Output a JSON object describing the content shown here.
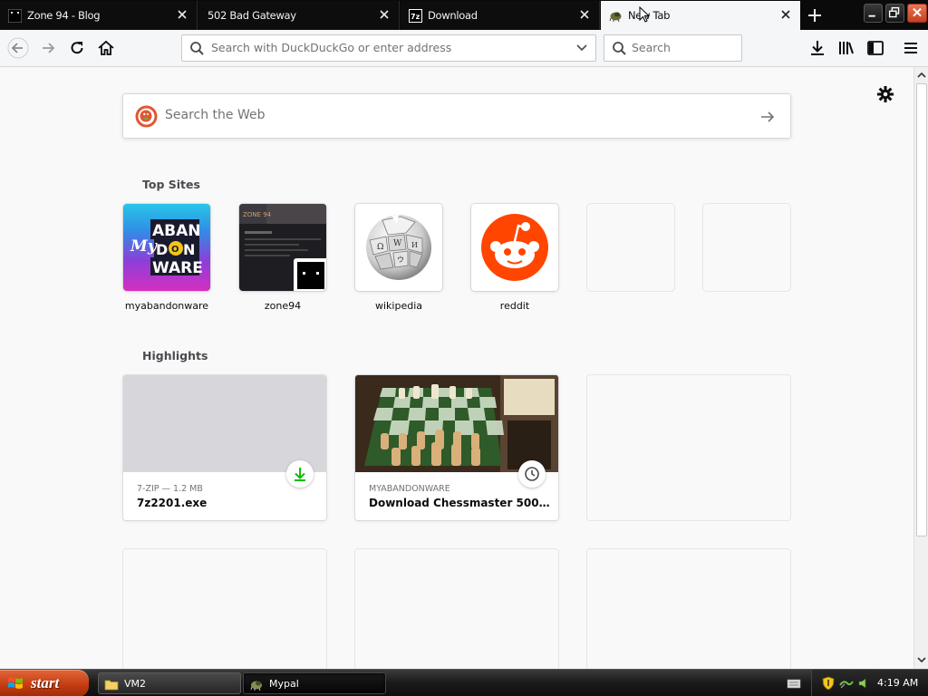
{
  "tabs": [
    {
      "title": "Zone 94 - Blog",
      "icon": "zone94-favicon"
    },
    {
      "title": "502 Bad Gateway",
      "icon": "blank-favicon"
    },
    {
      "title": "Download",
      "icon": "7zip-favicon"
    },
    {
      "title": "New Tab",
      "icon": "mypal-favicon",
      "active": true
    }
  ],
  "toolbar": {
    "url_placeholder": "Search with DuckDuckGo or enter address",
    "search_placeholder": "Search"
  },
  "newtab": {
    "websearch_placeholder": "Search the Web",
    "top_sites_title": "Top Sites",
    "highlights_title": "Highlights",
    "top_sites": [
      {
        "label": "myabandonware"
      },
      {
        "label": "zone94"
      },
      {
        "label": "wikipedia"
      },
      {
        "label": "reddit"
      }
    ],
    "highlights": [
      {
        "meta": "7-ZIP — 1.2 MB",
        "title": "7z2201.exe",
        "badge": "download-icon"
      },
      {
        "meta": "MYABANDONWARE",
        "title": "Download Chessmaster 5000 (W...",
        "badge": "clock-icon"
      }
    ]
  },
  "taskbar": {
    "start_label": "start",
    "items": [
      {
        "label": "VM2",
        "icon": "folder-icon"
      },
      {
        "label": "Mypal",
        "icon": "mypal-icon"
      }
    ],
    "clock": "4:19 AM"
  },
  "colors": {
    "accent_reddit": "#ff4500",
    "download_green": "#12bc00",
    "start_orange": "#c23a10"
  }
}
